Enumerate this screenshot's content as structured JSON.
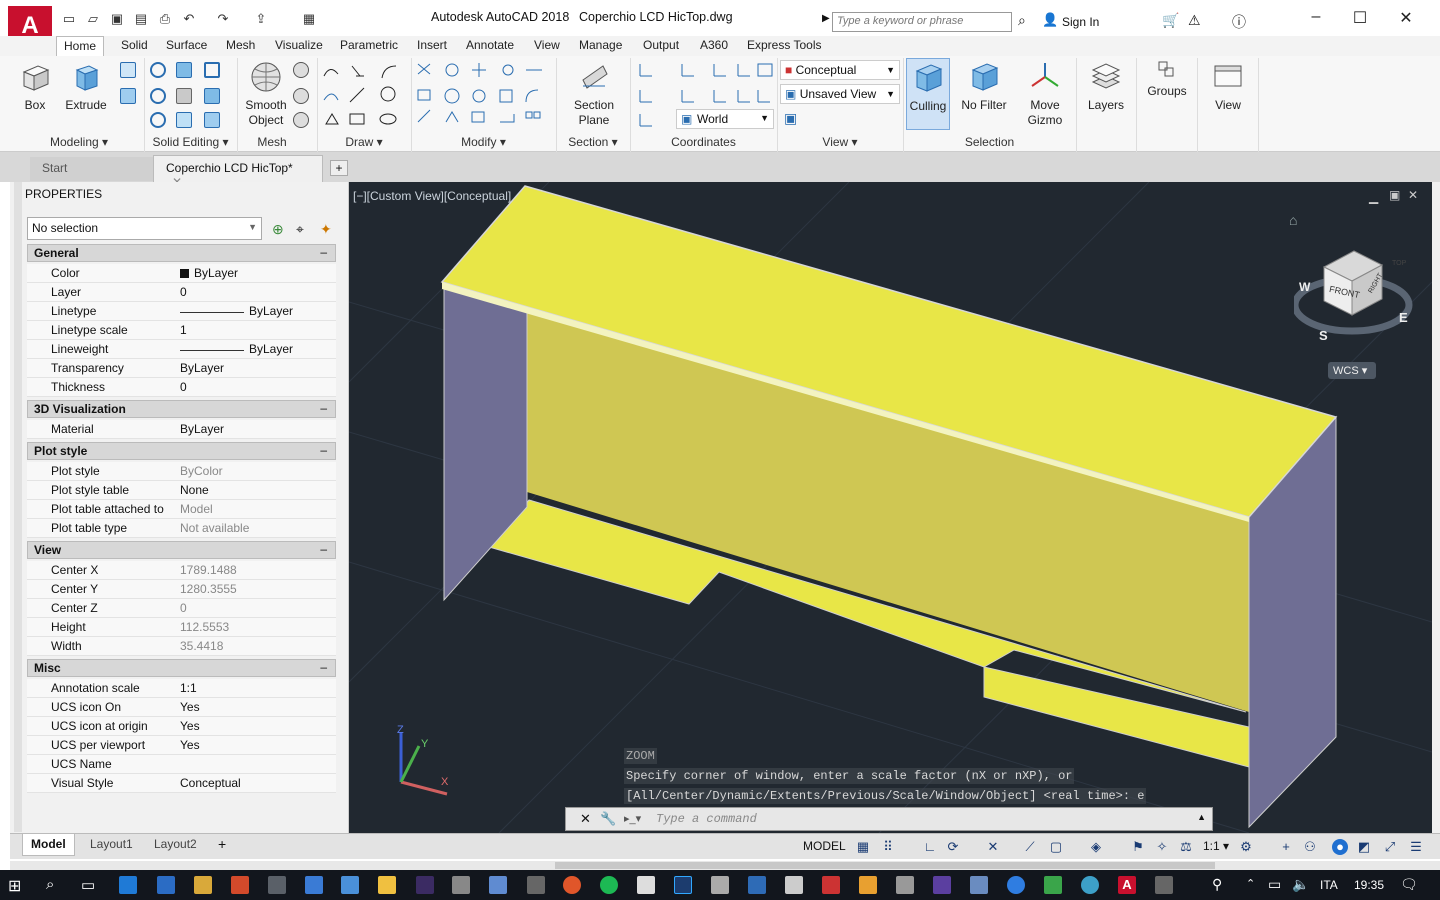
{
  "title_bar": {
    "app": "Autodesk AutoCAD 2018",
    "document": "Coperchio LCD HicTop.dwg",
    "search_placeholder": "Type a keyword or phrase",
    "sign_in": "Sign In"
  },
  "ribbon_tabs": [
    "Home",
    "Solid",
    "Surface",
    "Mesh",
    "Visualize",
    "Parametric",
    "Insert",
    "Annotate",
    "View",
    "Manage",
    "Output",
    "A360",
    "Express Tools"
  ],
  "ribbon": {
    "big_buttons": {
      "box": "Box",
      "extrude": "Extrude",
      "smooth_object": "Smooth Object",
      "section_plane": "Section Plane",
      "culling": "Culling",
      "no_filter": "No Filter",
      "move_gizmo": "Move Gizmo",
      "layers": "Layers",
      "groups": "Groups",
      "view": "View"
    },
    "panels": {
      "modeling": "Modeling",
      "solid_editing": "Solid Editing",
      "mesh": "Mesh",
      "draw": "Draw",
      "modify": "Modify",
      "section": "Section",
      "coordinates": "Coordinates",
      "view": "View",
      "selection": "Selection"
    },
    "visual_style": "Conceptual",
    "named_view": "Unsaved View",
    "ucs": "World"
  },
  "file_tabs": {
    "start": "Start",
    "document": "Coperchio LCD HicTop*"
  },
  "properties": {
    "title": "PROPERTIES",
    "selection": "No selection",
    "sections": {
      "general": {
        "title": "General",
        "rows": [
          [
            "Color",
            "ByLayer"
          ],
          [
            "Layer",
            "0"
          ],
          [
            "Linetype",
            "ByLayer"
          ],
          [
            "Linetype scale",
            "1"
          ],
          [
            "Lineweight",
            "ByLayer"
          ],
          [
            "Transparency",
            "ByLayer"
          ],
          [
            "Thickness",
            "0"
          ]
        ]
      },
      "visualization": {
        "title": "3D Visualization",
        "rows": [
          [
            "Material",
            "ByLayer"
          ]
        ]
      },
      "plot": {
        "title": "Plot style",
        "rows": [
          [
            "Plot style",
            "ByColor"
          ],
          [
            "Plot style table",
            "None"
          ],
          [
            "Plot table attached to",
            "Model"
          ],
          [
            "Plot table type",
            "Not available"
          ]
        ]
      },
      "view": {
        "title": "View",
        "rows": [
          [
            "Center X",
            "1789.1488"
          ],
          [
            "Center Y",
            "1280.3555"
          ],
          [
            "Center Z",
            "0"
          ],
          [
            "Height",
            "112.5553"
          ],
          [
            "Width",
            "35.4418"
          ]
        ]
      },
      "misc": {
        "title": "Misc",
        "rows": [
          [
            "Annotation scale",
            "1:1"
          ],
          [
            "UCS icon On",
            "Yes"
          ],
          [
            "UCS icon at origin",
            "Yes"
          ],
          [
            "UCS per viewport",
            "Yes"
          ],
          [
            "UCS Name",
            ""
          ],
          [
            "Visual Style",
            "Conceptual"
          ]
        ]
      }
    }
  },
  "viewport": {
    "label": "[−][Custom View][Conceptual]",
    "viewcube": {
      "top": "TOP",
      "front": "FRONT",
      "right": "RIGHT",
      "w": "W",
      "s": "S",
      "e": "E",
      "wcs": "WCS"
    },
    "ucs_axes": {
      "x": "X",
      "y": "Y",
      "z": "Z"
    },
    "command_history": [
      "ZOOM",
      "Specify corner of window, enter a scale factor (nX or nXP), or",
      "[All/Center/Dynamic/Extents/Previous/Scale/Window/Object] <real time>: e"
    ],
    "command_placeholder": "Type a command"
  },
  "layout_tabs": [
    "Model",
    "Layout1",
    "Layout2"
  ],
  "status": {
    "model": "MODEL",
    "scale": "1:1"
  },
  "taskbar": {
    "language": "ITA",
    "time": "19:35"
  },
  "colors": {
    "accent": "#c8102e",
    "viewport_bg": "#212830",
    "object_yellow": "#e8e647",
    "object_side": "#6f6e94"
  }
}
